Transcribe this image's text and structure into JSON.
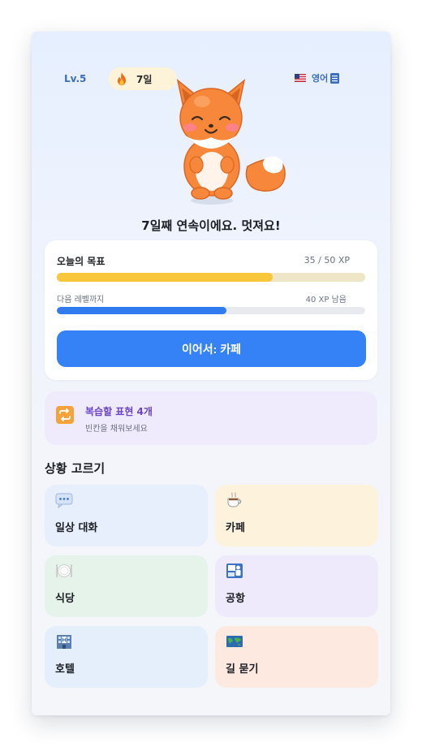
{
  "header": {
    "level": "Lv.5",
    "streak": "7일",
    "language": "영어",
    "icons": [
      "fire-icon",
      "us-flag-icon",
      "language-menu-icon"
    ]
  },
  "headline": "7일째 연속이에요. 멋져요!",
  "goal": {
    "title": "오늘의 목표",
    "xp_text": "35 / 50 XP",
    "progress": 0.7,
    "next_label": "다음 레벨까지",
    "remaining_text": "40 XP 남음",
    "level_progress": 0.55,
    "continue_label": "이어서: 카페"
  },
  "review": {
    "title": "복습할 표현 4개",
    "subtitle": "빈칸을 채워보세요",
    "icon": "repeat-icon"
  },
  "section_title": "상황 고르기",
  "scenarios": [
    {
      "label": "일상 대화",
      "icon": "speech-bubble-icon"
    },
    {
      "label": "카페",
      "icon": "coffee-icon"
    },
    {
      "label": "식당",
      "icon": "plate-icon"
    },
    {
      "label": "공항",
      "icon": "passport-control-icon"
    },
    {
      "label": "호텔",
      "icon": "hotel-icon"
    },
    {
      "label": "길 묻기",
      "icon": "map-icon"
    }
  ],
  "colors": {
    "accent": "#3482f6",
    "goal_bar": "#f8c73b",
    "review_text": "#6a45c9"
  }
}
